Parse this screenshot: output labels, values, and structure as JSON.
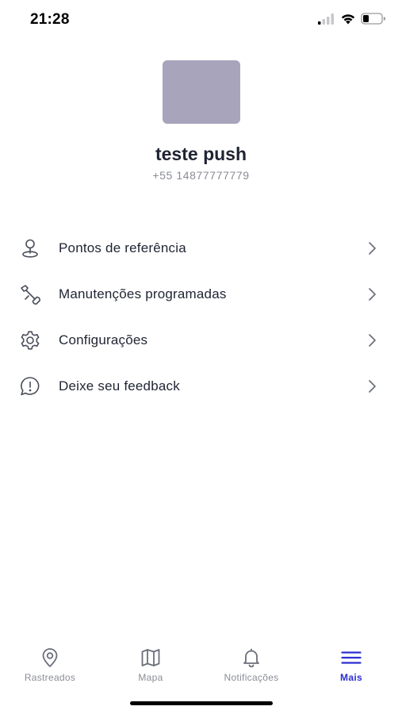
{
  "status_bar": {
    "time": "21:28",
    "icons": [
      "signal-icon",
      "wifi-icon",
      "battery-icon"
    ]
  },
  "profile": {
    "name": "teste push",
    "phone": "+55 14877777779",
    "avatar_color": "#a7a4bb"
  },
  "menu": {
    "items": [
      {
        "label": "Pontos de referência",
        "icon": "location-pin-icon"
      },
      {
        "label": "Manutenções programadas",
        "icon": "wrench-icon"
      },
      {
        "label": "Configurações",
        "icon": "gear-icon"
      },
      {
        "label": "Deixe seu feedback",
        "icon": "feedback-icon"
      }
    ]
  },
  "bottom_nav": {
    "active": "Mais",
    "active_color": "#2a2fd1",
    "items": [
      {
        "label": "Rastreados",
        "icon": "location-pin-icon"
      },
      {
        "label": "Mapa",
        "icon": "map-icon"
      },
      {
        "label": "Notificações",
        "icon": "bell-icon"
      },
      {
        "label": "Mais",
        "icon": "menu-icon"
      }
    ]
  }
}
